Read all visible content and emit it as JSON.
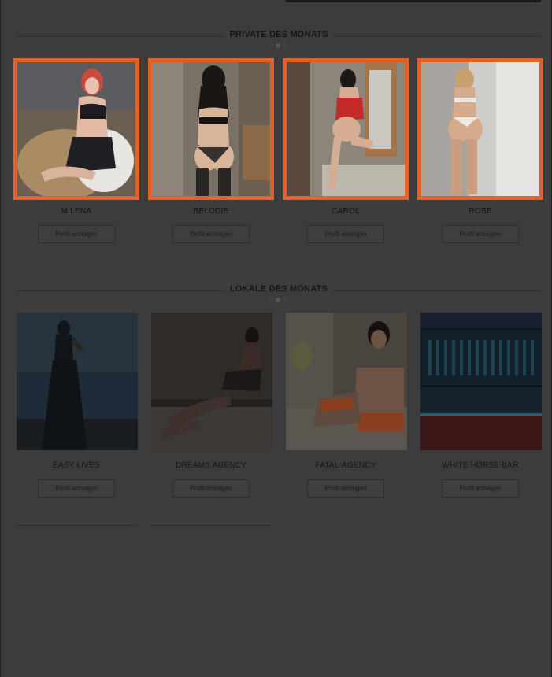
{
  "sections": [
    {
      "title": "PRIVATE DES MONATS",
      "cards": [
        {
          "name": "MILENA",
          "button": "Profil anzeigen"
        },
        {
          "name": "BELODIE",
          "button": "Profil anzeigen"
        },
        {
          "name": "CAROL",
          "button": "Profil anzeigen"
        },
        {
          "name": "ROSE",
          "button": "Profil anzeigen"
        }
      ]
    },
    {
      "title": "LOKALE DES MONATS",
      "cards": [
        {
          "name": "EASY LIVES",
          "button": "Profil anzeigen"
        },
        {
          "name": "DREAMS AGENCY",
          "button": "Profil anzeigen"
        },
        {
          "name": "FATAL-AGENCY",
          "button": "Profil anzeigen"
        },
        {
          "name": "WHITE HORSE BAR",
          "button": "Profil anzeigen"
        }
      ]
    }
  ],
  "colors": {
    "overlay_bg": "#3c3c3c",
    "highlight_frame": "#e2622a"
  }
}
